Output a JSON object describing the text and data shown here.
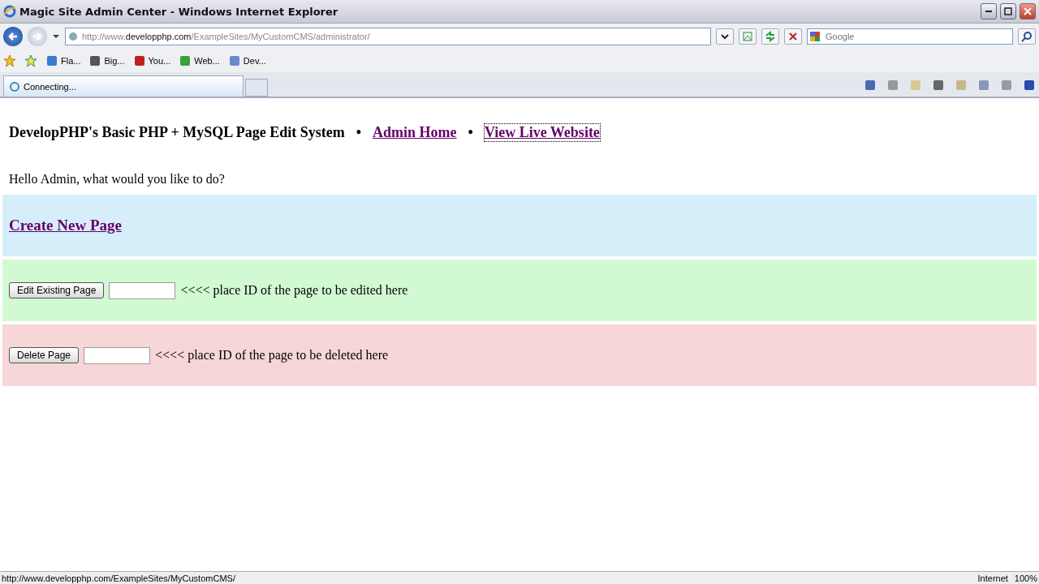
{
  "window": {
    "title": "Magic Site Admin Center - Windows Internet Explorer"
  },
  "address_bar": {
    "url_prefix": "http://www.",
    "url_domain": "developphp.com",
    "url_path": "/ExampleSites/MyCustomCMS/administrator/"
  },
  "search": {
    "placeholder": "Google"
  },
  "favorites": [
    {
      "label": "Fla..."
    },
    {
      "label": "Big..."
    },
    {
      "label": "You..."
    },
    {
      "label": "Web..."
    },
    {
      "label": "Dev..."
    }
  ],
  "tabs": [
    {
      "label": "Connecting...",
      "selected": true
    }
  ],
  "page": {
    "site_title": "DevelopPHP's Basic PHP + MySQL Page Edit System",
    "separator": "•",
    "nav_links": [
      {
        "label": "Admin Home",
        "focused": false
      },
      {
        "label": "View Live Website",
        "focused": true
      }
    ],
    "greeting": "Hello Admin, what would you like to do?",
    "sections": [
      {
        "kind": "link",
        "color": "#d6eefa",
        "label": "Create New Page"
      },
      {
        "kind": "form",
        "color": "#d2fad2",
        "button": "Edit Existing Page",
        "hint": "<<<< place ID of the page to be edited here"
      },
      {
        "kind": "form",
        "color": "#f7d6d8",
        "button": "Delete Page",
        "hint": "<<<< place ID of the page to be deleted here"
      }
    ]
  },
  "status_bar": {
    "url": "http://www.developphp.com/ExampleSites/MyCustomCMS/",
    "zone": "Internet",
    "zoom": "100%"
  }
}
